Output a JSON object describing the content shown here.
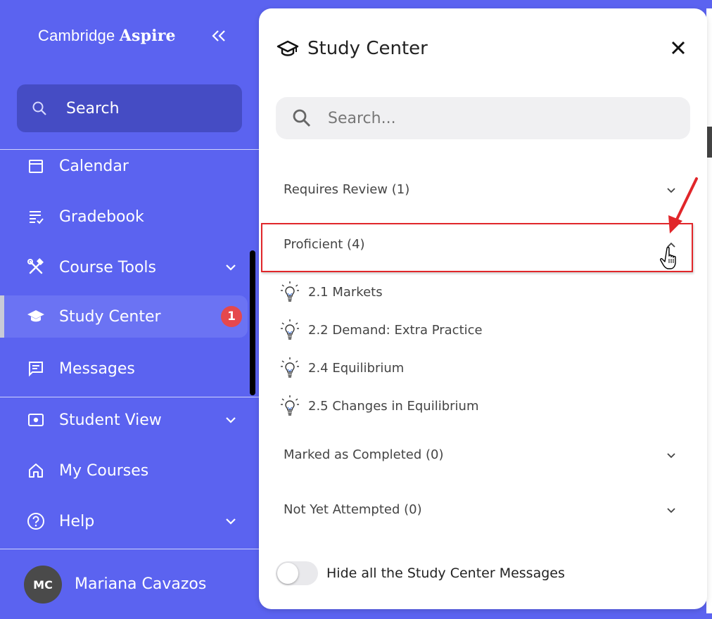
{
  "sidebar": {
    "brand_light": "Cambridge",
    "brand_bold": "Aspire",
    "search_label": "Search",
    "items": [
      {
        "label": "Calendar",
        "icon": "calendar-icon"
      },
      {
        "label": "Gradebook",
        "icon": "gradebook-icon"
      },
      {
        "label": "Course Tools",
        "icon": "tools-icon",
        "expandable": true
      },
      {
        "label": "Study Center",
        "icon": "graduation-cap-icon",
        "active": true,
        "badge": "1"
      },
      {
        "label": "Messages",
        "icon": "message-icon"
      },
      {
        "label": "Student View",
        "icon": "eye-icon",
        "expandable": true
      },
      {
        "label": "My Courses",
        "icon": "home-icon"
      },
      {
        "label": "Help",
        "icon": "help-icon",
        "expandable": true
      }
    ],
    "user": {
      "initials": "MC",
      "name": "Mariana Cavazos"
    }
  },
  "panel": {
    "title": "Study Center",
    "search_placeholder": "Search...",
    "sections": [
      {
        "label": "Requires Review (1)",
        "expanded": false
      },
      {
        "label": "Proficient (4)",
        "expanded": true,
        "items": [
          "2.1 Markets",
          "2.2 Demand: Extra Practice",
          "2.4 Equilibrium",
          "2.5 Changes in Equilibrium"
        ]
      },
      {
        "label": "Marked as Completed (0)",
        "expanded": false
      },
      {
        "label": "Not Yet Attempted (0)",
        "expanded": false
      }
    ],
    "toggle_label": "Hide all the Study Center Messages",
    "toggle_on": false
  },
  "colors": {
    "sidebar_bg": "#5b63f0",
    "sidebar_search_bg": "#454cc4",
    "active_item_bg": "#6b73f3",
    "badge": "#e5484d",
    "highlight": "#e1262a"
  }
}
